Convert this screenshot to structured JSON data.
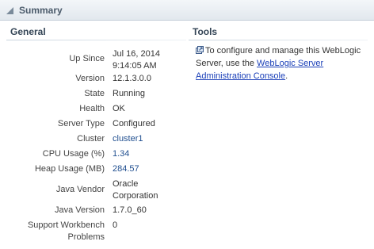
{
  "panel": {
    "title": "Summary"
  },
  "general": {
    "title": "General",
    "rows": [
      {
        "label": "Up Since",
        "value": "Jul 16, 2014\n9:14:05 AM"
      },
      {
        "label": "Version",
        "value": "12.1.3.0.0"
      },
      {
        "label": "State",
        "value": "Running"
      },
      {
        "label": "Health",
        "value": "OK"
      },
      {
        "label": "Server Type",
        "value": "Configured"
      },
      {
        "label": "Cluster",
        "value": "cluster1"
      },
      {
        "label": "CPU Usage (%)",
        "value": "1.34"
      },
      {
        "label": "Heap Usage (MB)",
        "value": "284.57"
      },
      {
        "label": "Java Vendor",
        "value": "Oracle\nCorporation"
      },
      {
        "label": "Java Version",
        "value": "1.7.0_60"
      },
      {
        "label": "Support Workbench\nProblems",
        "value": "0"
      }
    ]
  },
  "tools": {
    "title": "Tools",
    "text_before": "To configure and manage this WebLogic Server, use the ",
    "link_text": "WebLogic Server Administration Console",
    "text_after": "."
  },
  "colors": {
    "link": "#1a3fb8",
    "header_bg": "#e2e8ee"
  }
}
